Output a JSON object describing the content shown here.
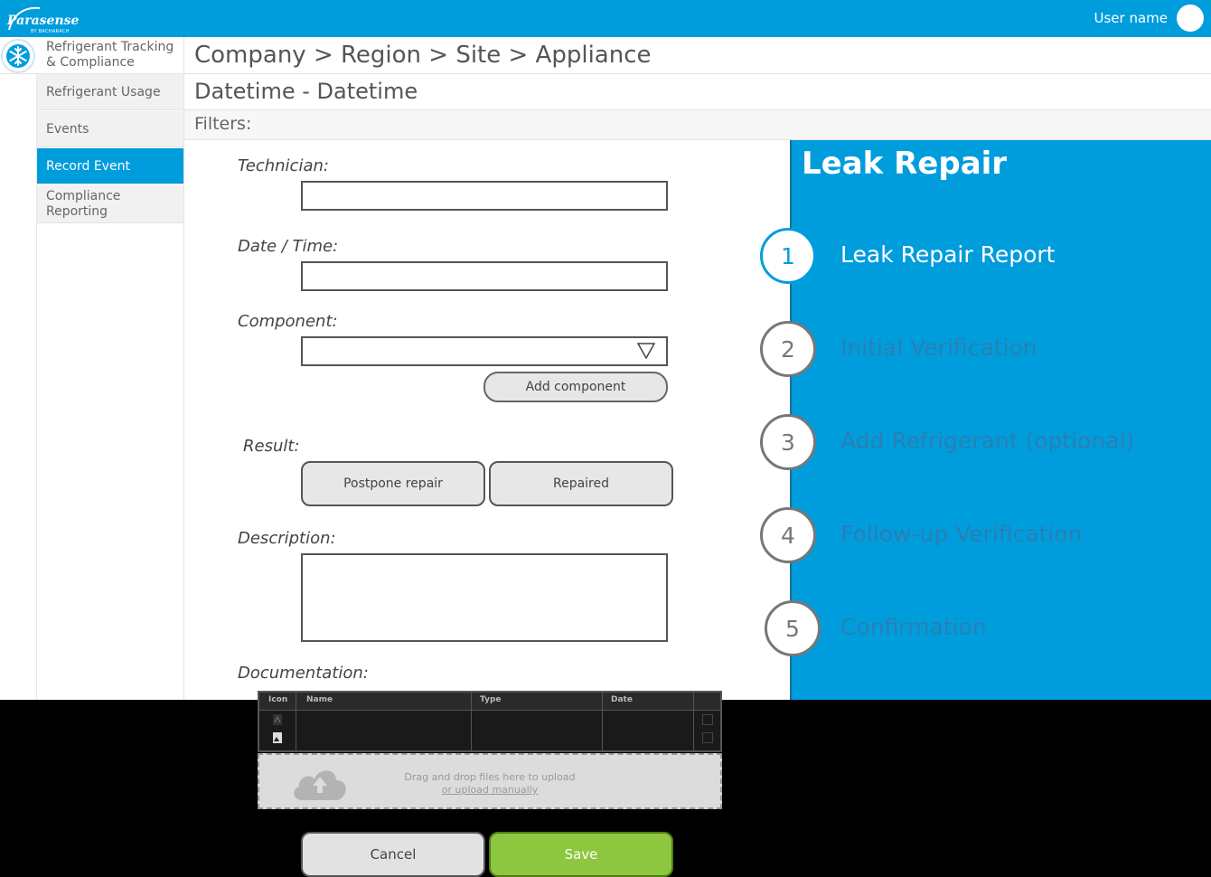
{
  "header": {
    "brand": "Parasense",
    "brand_sub": "BY BACHARACH",
    "user_name": "User name"
  },
  "sidebar": {
    "app_title_line1": "Refrigerant Tracking",
    "app_title_line2": "& Compliance",
    "items": [
      {
        "label": "Refrigerant Usage"
      },
      {
        "label": "Events"
      },
      {
        "label": "Record Event"
      },
      {
        "label_line1": "Compliance",
        "label_line2": "Reporting"
      }
    ]
  },
  "page": {
    "breadcrumb": "Company > Region > Site > Appliance",
    "date_range": "Datetime - Datetime",
    "filters_label": "Filters:"
  },
  "form": {
    "technician_label": "Technician:",
    "technician_value": "",
    "datetime_label": "Date / Time:",
    "datetime_value": "",
    "component_label": "Component:",
    "component_value": "",
    "add_component_label": "Add component",
    "result_label": "Result:",
    "postpone_label": "Postpone repair",
    "repaired_label": "Repaired",
    "description_label": "Description:",
    "description_value": "",
    "documentation_label": "Documentation:"
  },
  "documents": {
    "columns": [
      "Icon",
      "Name",
      "Type",
      "Date"
    ]
  },
  "upload": {
    "line1": "Drag and drop files here to upload",
    "line2": "or upload manually"
  },
  "actions": {
    "cancel_label": "Cancel",
    "save_label": "Save"
  },
  "wizard": {
    "title": "Leak Repair",
    "steps": [
      {
        "number": "1",
        "label": "Leak Repair Report"
      },
      {
        "number": "2",
        "label": "Initial Verification"
      },
      {
        "number": "3",
        "label": "Add Refrigerant (optional)"
      },
      {
        "number": "4",
        "label": "Follow-up Verification"
      },
      {
        "number": "5",
        "label": "Confirmation"
      }
    ]
  },
  "colors": {
    "primary": "#009ddc",
    "save": "#8dc63f"
  }
}
